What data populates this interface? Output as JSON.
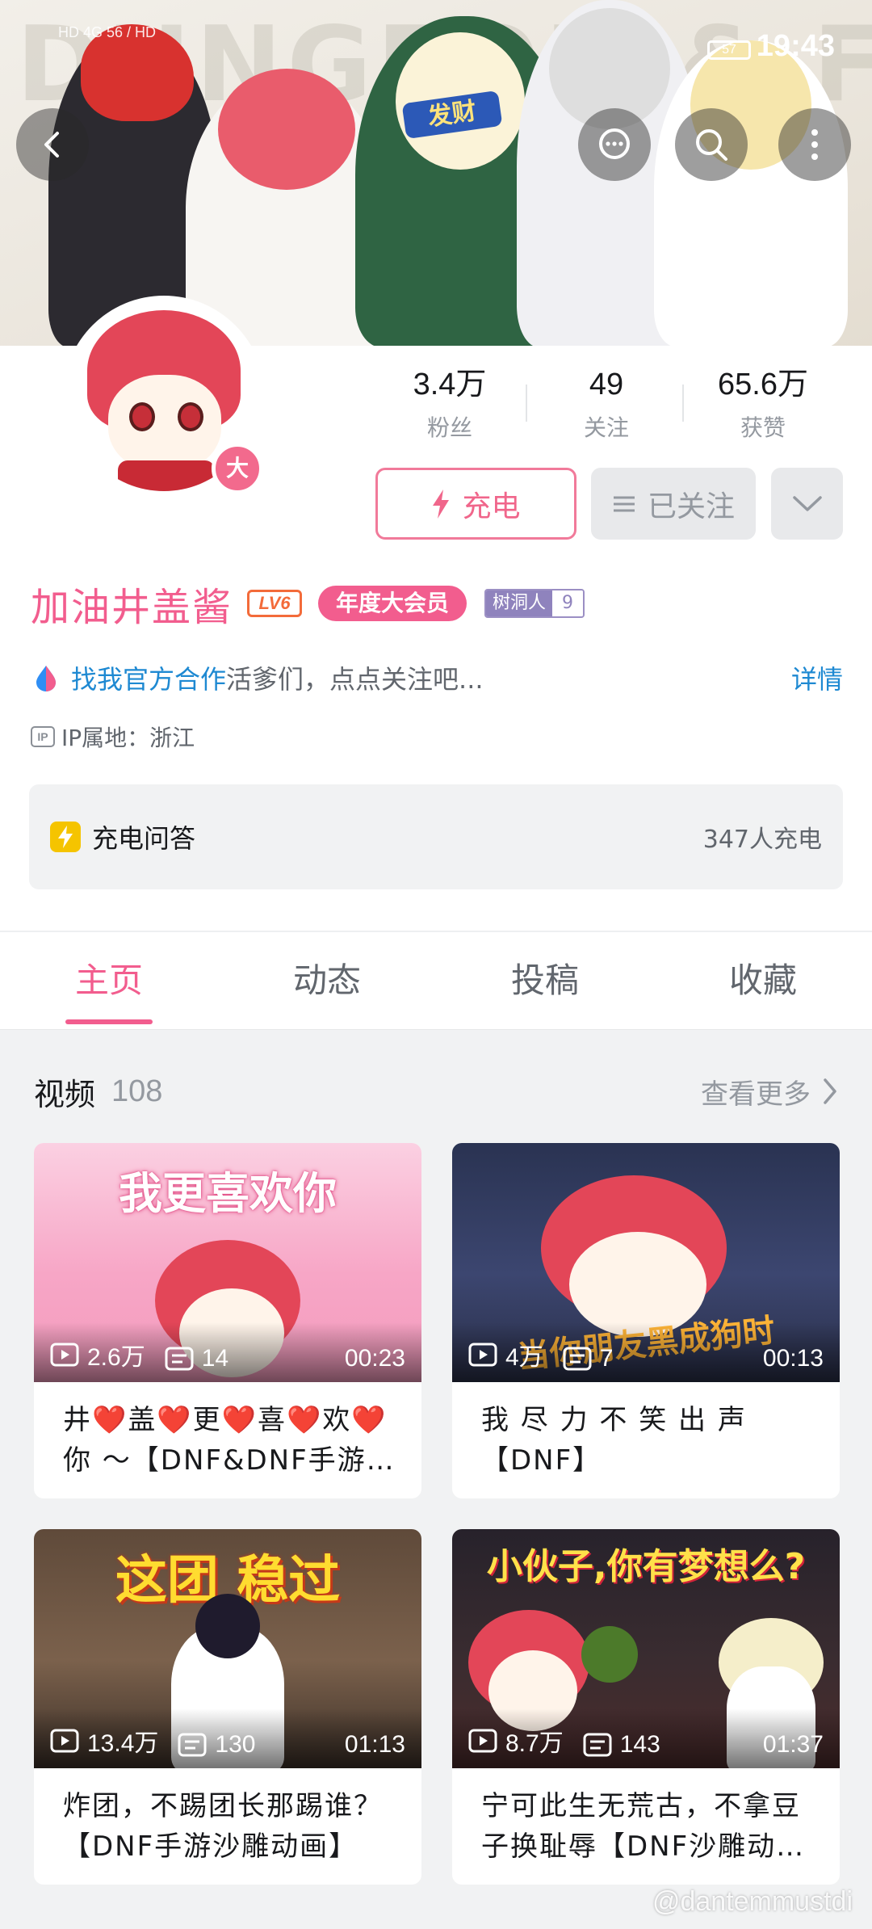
{
  "status_bar": {
    "signal_text": "HD 4G 56 / HD",
    "battery": "57",
    "time": "19:43"
  },
  "banner": {
    "art_text": "DUNGEON & FIGHTER",
    "headband_text": "发财"
  },
  "profile": {
    "name": "加油井盖酱",
    "level_badge": "LV6",
    "vip_avatar_badge": "大",
    "member_badge": "年度大会员",
    "medal_name": "树洞人",
    "medal_level": "9",
    "stats": [
      {
        "value": "3.4万",
        "label": "粉丝"
      },
      {
        "value": "49",
        "label": "关注"
      },
      {
        "value": "65.6万",
        "label": "获赞"
      }
    ],
    "charge_button": "充电",
    "follow_button": "已关注",
    "sign_link": "找我官方合作",
    "sign_text": "活爹们，点点关注吧...",
    "sign_detail": "详情",
    "ip_tag": "IP",
    "ip_text": "IP属地：浙江"
  },
  "charge_card": {
    "title": "充电问答",
    "count": "347人充电"
  },
  "tabs": [
    {
      "label": "主页",
      "active": true
    },
    {
      "label": "动态",
      "active": false
    },
    {
      "label": "投稿",
      "active": false
    },
    {
      "label": "收藏",
      "active": false
    }
  ],
  "videos_section": {
    "title": "视频",
    "count": "108",
    "more": "查看更多"
  },
  "videos": [
    {
      "art_title": "我更喜欢你",
      "views": "2.6万",
      "danmaku": "14",
      "duration": "00:23",
      "title": "井❤️盖❤️更❤️喜❤️欢❤️你 ～【DNF&DNF手游沙雕动画】"
    },
    {
      "art_title": "当你朋友黑成狗时",
      "views": "4万",
      "danmaku": "7",
      "duration": "00:13",
      "title": "我 尽 力 不 笑 出 声 【DNF】"
    },
    {
      "art_title": "这团 稳过",
      "views": "13.4万",
      "danmaku": "130",
      "duration": "01:13",
      "title": "炸团，不踢团长那踢谁？【DNF手游沙雕动画】"
    },
    {
      "art_title": "小伙子,你有梦想么?",
      "views": "8.7万",
      "danmaku": "143",
      "duration": "01:37",
      "title": "宁可此生无荒古，不拿豆子换耻辱【DNF沙雕动画】"
    }
  ],
  "watermark": "@dantemmustdi",
  "colors": {
    "brand_pink": "#f25d8e",
    "link_blue": "#1e89d2",
    "charge_yellow": "#f5c400"
  }
}
